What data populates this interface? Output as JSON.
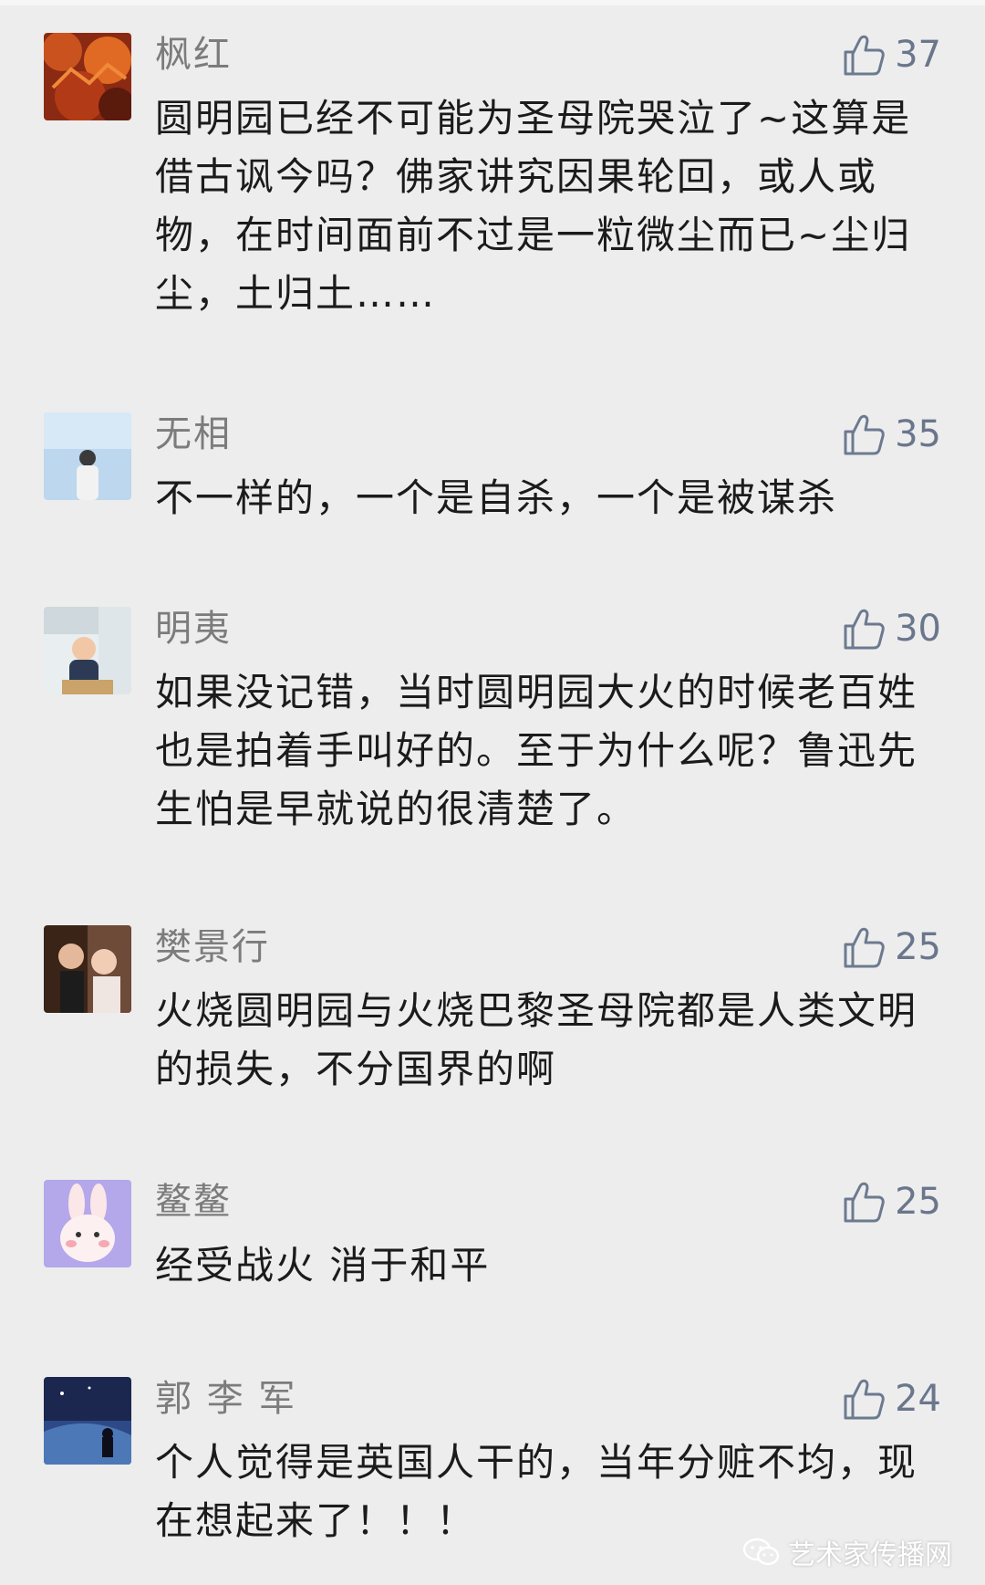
{
  "comments": [
    {
      "name": "枫红",
      "likes": "37",
      "text": "圆明园已经不可能为圣母院哭泣了~这算是借古讽今吗？佛家讲究因果轮回，或人或物，在时间面前不过是一粒微尘而已~尘归尘，土归土……"
    },
    {
      "name": "无相",
      "likes": "35",
      "text": "不一样的，一个是自杀，一个是被谋杀"
    },
    {
      "name": "明夷",
      "likes": "30",
      "text": "如果没记错，当时圆明园大火的时候老百姓也是拍着手叫好的。至于为什么呢？鲁迅先生怕是早就说的很清楚了。"
    },
    {
      "name": "樊景行",
      "likes": "25",
      "text": "火烧圆明园与火烧巴黎圣母院都是人类文明的损失，不分国界的啊"
    },
    {
      "name": "鳌鳌",
      "likes": "25",
      "text": "经受战火 消于和平"
    },
    {
      "name": "郭 李 军",
      "likes": "24",
      "text": "个人觉得是英国人干的，当年分赃不均，现在想起来了！！！"
    }
  ],
  "watermark": {
    "text": "艺术家传播网",
    "icon": "wechat-icon"
  },
  "icons": {
    "like": "thumbs-up-icon"
  },
  "colors": {
    "background": "#ededed",
    "name_text": "#7c7c7c",
    "like_icon": "#6c7a90",
    "body_text": "#1b1b1b"
  }
}
